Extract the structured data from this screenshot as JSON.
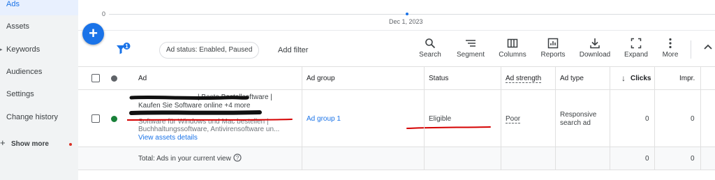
{
  "sidebar": {
    "items": [
      {
        "label": "Ads",
        "active": true
      },
      {
        "label": "Assets"
      },
      {
        "label": "Keywords",
        "has_arrow": true
      },
      {
        "label": "Audiences"
      },
      {
        "label": "Settings"
      },
      {
        "label": "Change history"
      }
    ],
    "show_more": "Show more"
  },
  "chart": {
    "y_zero": "0",
    "date": "Dec 1, 2023"
  },
  "toolbar": {
    "filter_badge": "1",
    "status_chip": "Ad status: Enabled, Paused",
    "add_filter": "Add filter",
    "tools": [
      {
        "label": "Search",
        "icon": "search-icon"
      },
      {
        "label": "Segment",
        "icon": "segment-icon"
      },
      {
        "label": "Columns",
        "icon": "columns-icon"
      },
      {
        "label": "Reports",
        "icon": "reports-icon"
      },
      {
        "label": "Download",
        "icon": "download-icon"
      },
      {
        "label": "Expand",
        "icon": "expand-icon"
      },
      {
        "label": "More",
        "icon": "more-vert-icon"
      }
    ]
  },
  "table": {
    "headers": {
      "ad": "Ad",
      "ad_group": "Ad group",
      "status": "Status",
      "ad_strength": "Ad strength",
      "ad_type": "Ad type",
      "clicks": "Clicks",
      "impr": "Impr."
    },
    "row": {
      "headline_tail": "| Beste Bestellsoftware |",
      "headline_2": "Kaufen Sie Software online",
      "more": "+4 more",
      "desc_1": "Software für Windows und Mac bestellen |",
      "desc_2": "Buchhaltungssoftware, Antivirensoftware un...",
      "view_assets": "View assets details",
      "ad_group": "Ad group 1",
      "status": "Eligible",
      "ad_strength": "Poor",
      "ad_type_1": "Responsive",
      "ad_type_2": "search ad",
      "clicks": "0",
      "impr": "0"
    },
    "total": {
      "label": "Total: Ads in your current view",
      "clicks": "0",
      "impr": "0"
    }
  },
  "colors": {
    "accent": "#1a73e8",
    "sidebar_bg": "#f1f3f4",
    "status_green": "#188038",
    "annotation_red": "#d50000"
  }
}
